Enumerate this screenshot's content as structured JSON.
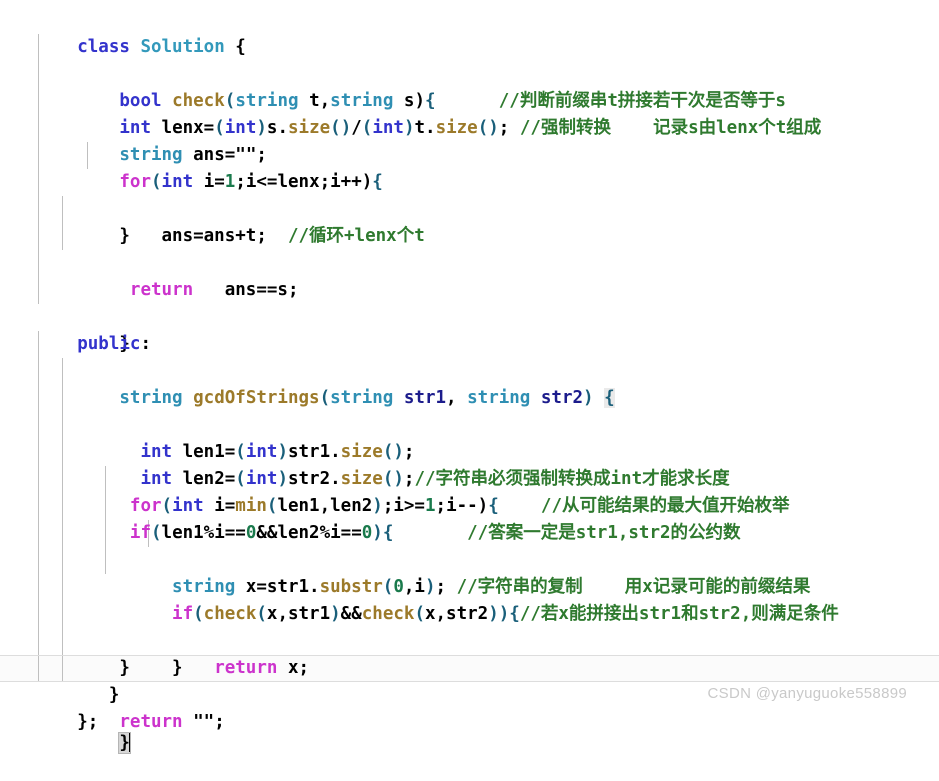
{
  "editor": {
    "language": "cpp",
    "background": "#ffffff",
    "current_line_background": "#fbfbfb",
    "caret_color": "#000000",
    "colors": {
      "keyword_blue": "#3333cc",
      "keyword_magenta": "#cc33cc",
      "type_teal": "#3399bb",
      "function_gold": "#9c7a2a",
      "number_green": "#1a7a4c",
      "variable_navy": "#1c1c8c",
      "comment_green": "#2f7a2f",
      "indent_guide": "#bfbfbf",
      "bracket_match": "#d6d6d6",
      "watermark": "#c9c9c9"
    }
  },
  "code": {
    "lines": [
      "class Solution {",
      "    bool check(string t,string s){      //判断前缀串t拼接若干次是否等于s",
      "    int lenx=(int)s.size()/(int)t.size(); //强制转换    记录s由lenx个t组成",
      "    string ans=\"\";",
      "    for(int i=1;i<=lenx;i++){",
      "        ans=ans+t;  //循环+lenx个t",
      "    }",
      "     return   ans==s;",
      "",
      "    }",
      "public:",
      "    string gcdOfStrings(string str1, string str2) {",
      "      int len1=(int)str1.size();",
      "      int len2=(int)str2.size();//字符串必须强制转换成int才能求长度",
      "     for(int i=min(len1,len2);i>=1;i--){    //从可能结果的最大值开始枚举",
      "     if(len1%i==0&&len2%i==0){       //答案一定是str1,str2的公约数",
      "         string x=str1.substr(0,i); //字符串的复制    用x记录可能的前缀结果",
      "         if(check(x,str1)&&check(x,str2)){//若x能拼接出str1和str2,则满足条件",
      "             return x;",
      "         }",
      "    }",
      "    }",
      "    return \"\";",
      "    }",
      "};"
    ],
    "comments": [
      "//判断前缀串t拼接若干次是否等于s",
      "//强制转换    记录s由lenx个t组成",
      "//循环+lenx个t",
      "//字符串必须强制转换成int才能求长度",
      "//从可能结果的最大值开始枚举",
      "//答案一定是str1,str2的公约数",
      "//字符串的复制    用x记录可能的前缀结果",
      "//若x能拼接出str1和str2,则满足条件"
    ]
  },
  "watermark": {
    "text": "CSDN @yanyuguoke558899"
  }
}
